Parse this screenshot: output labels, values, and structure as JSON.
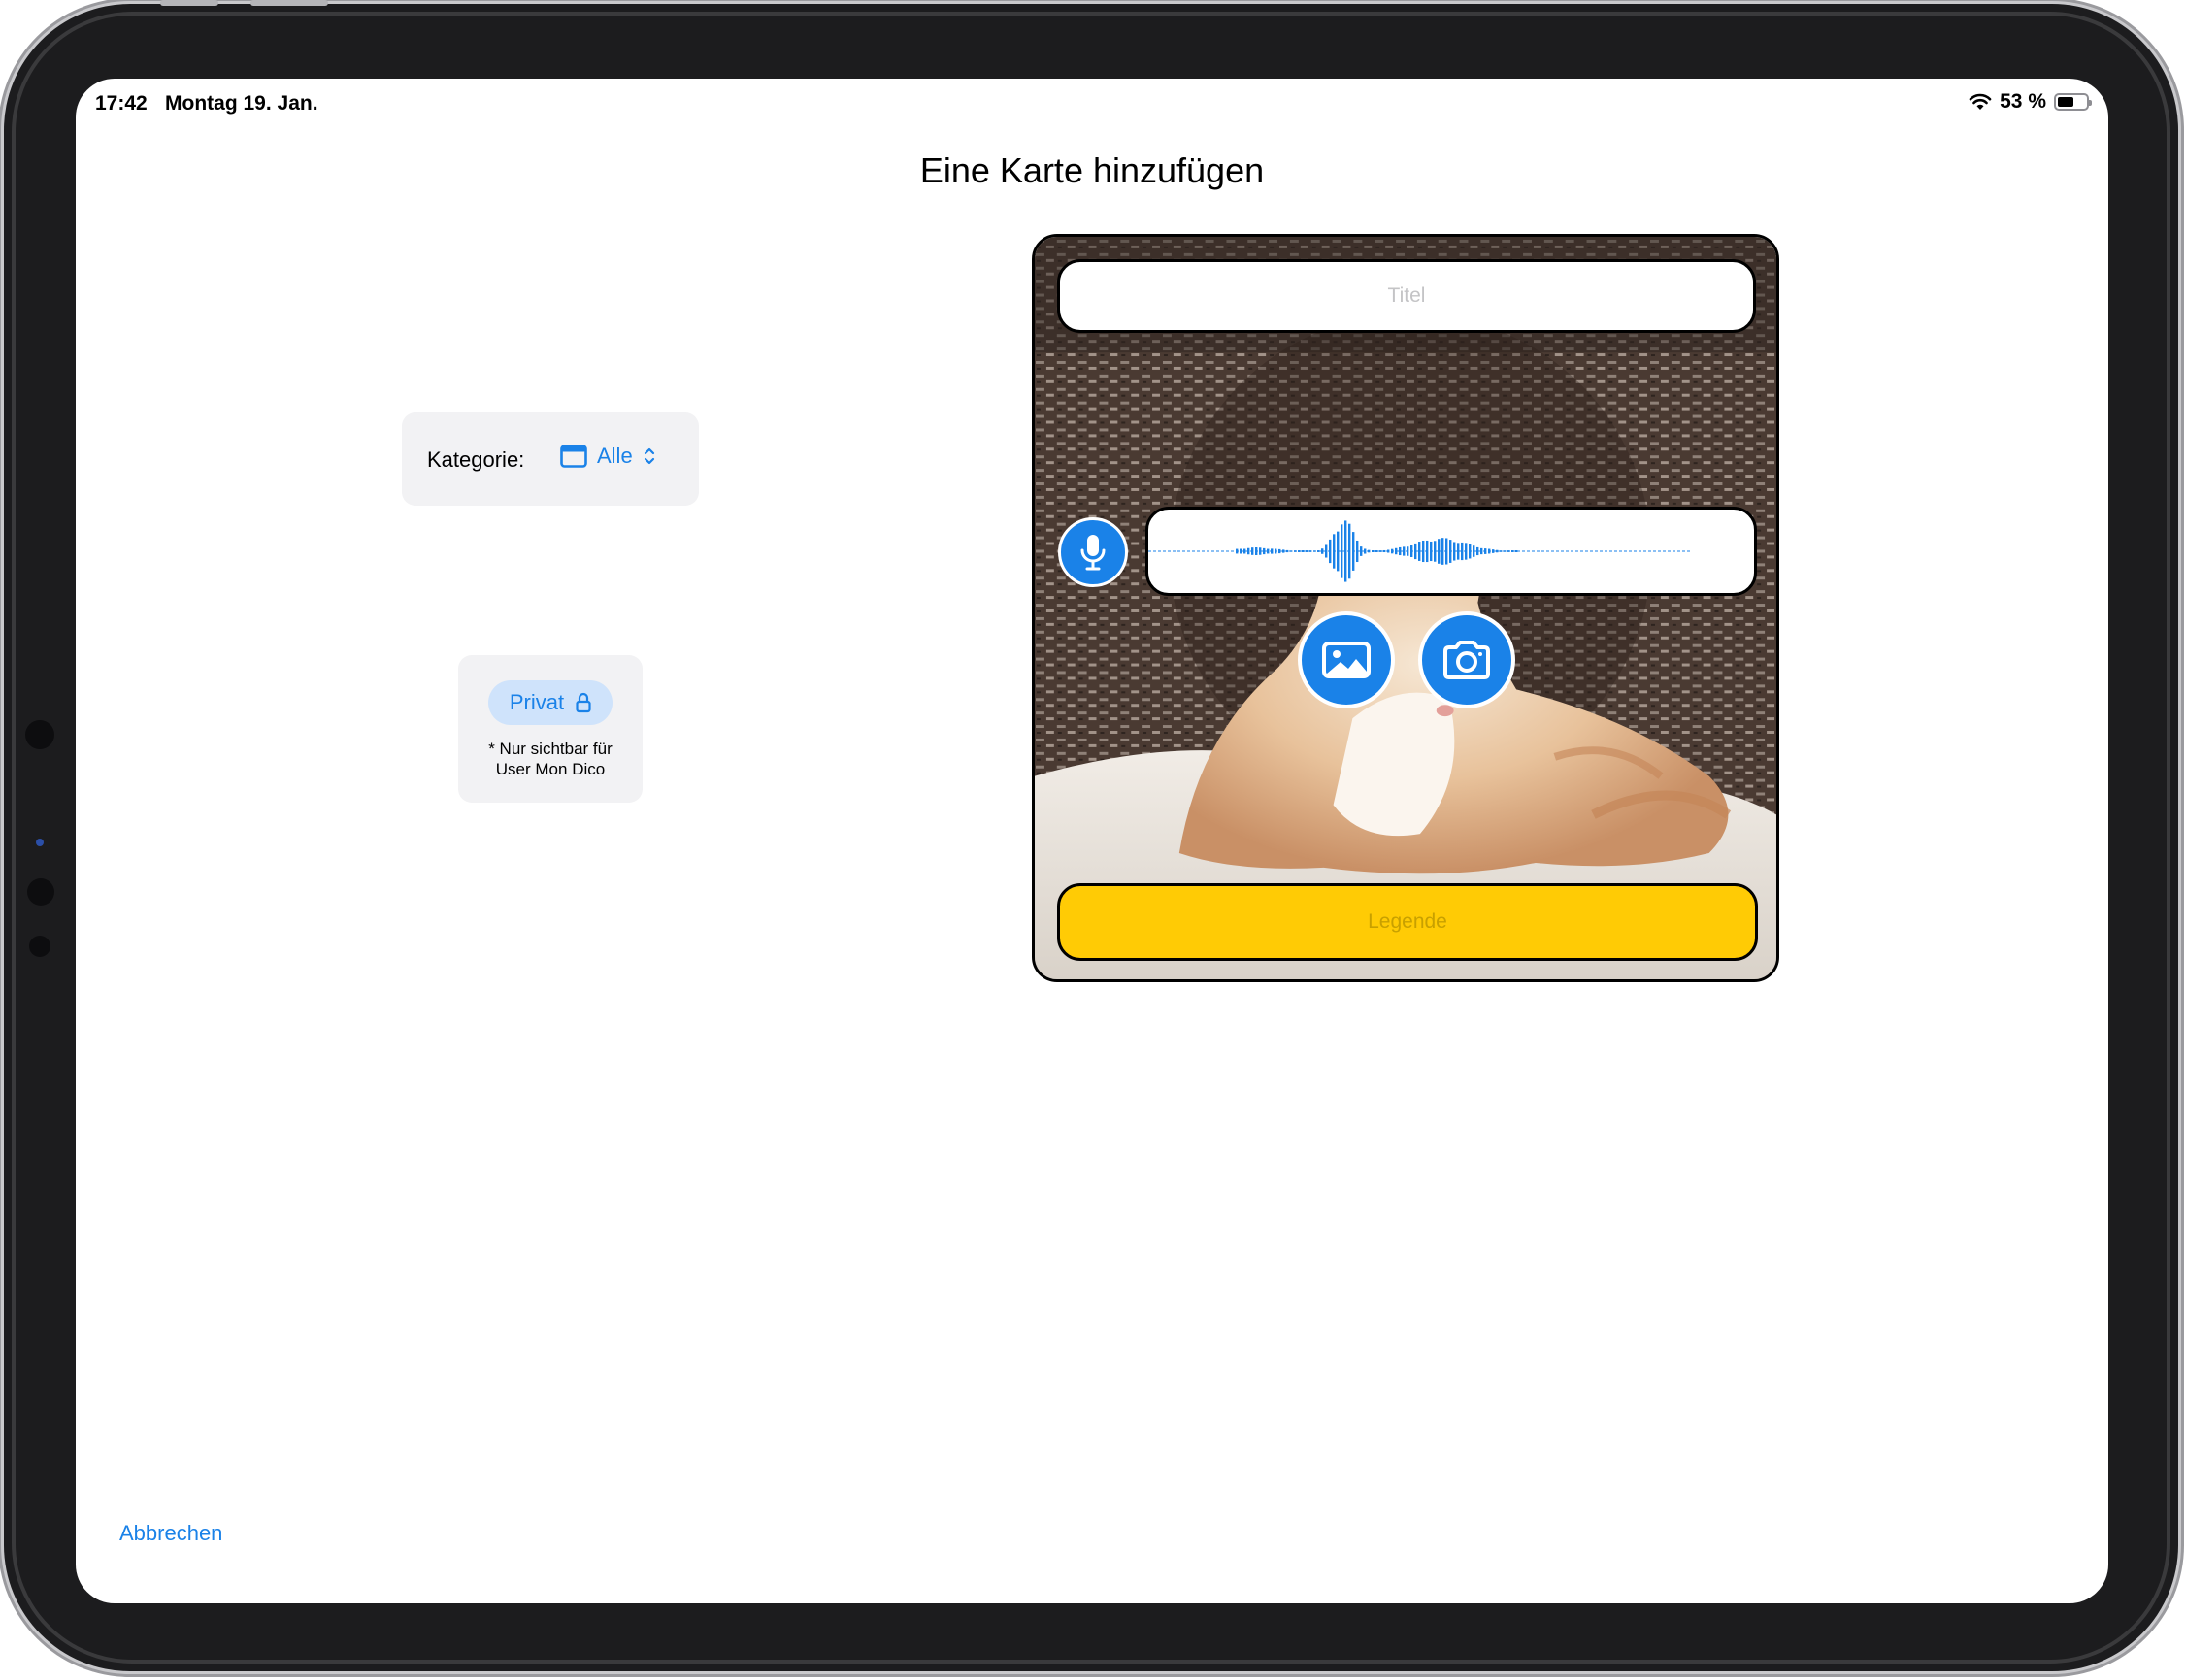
{
  "status_bar": {
    "time": "17:42",
    "date": "Montag 19. Jan.",
    "battery": "53 %",
    "battery_level": 0.53
  },
  "header": {
    "title": "Eine Karte hinzufügen"
  },
  "category": {
    "label": "Kategorie:",
    "value": "Alle"
  },
  "privacy": {
    "toggle_label": "Privat",
    "note_line1": "* Nur sichtbar für",
    "note_line2": "User Mon Dico"
  },
  "card": {
    "title_placeholder": "Titel",
    "legend_placeholder": "Legende"
  },
  "footer": {
    "cancel_label": "Abbrechen"
  },
  "colors": {
    "accent": "#1a82e8",
    "legend_yellow": "#ffcb05",
    "panel_gray": "#f2f2f4"
  }
}
